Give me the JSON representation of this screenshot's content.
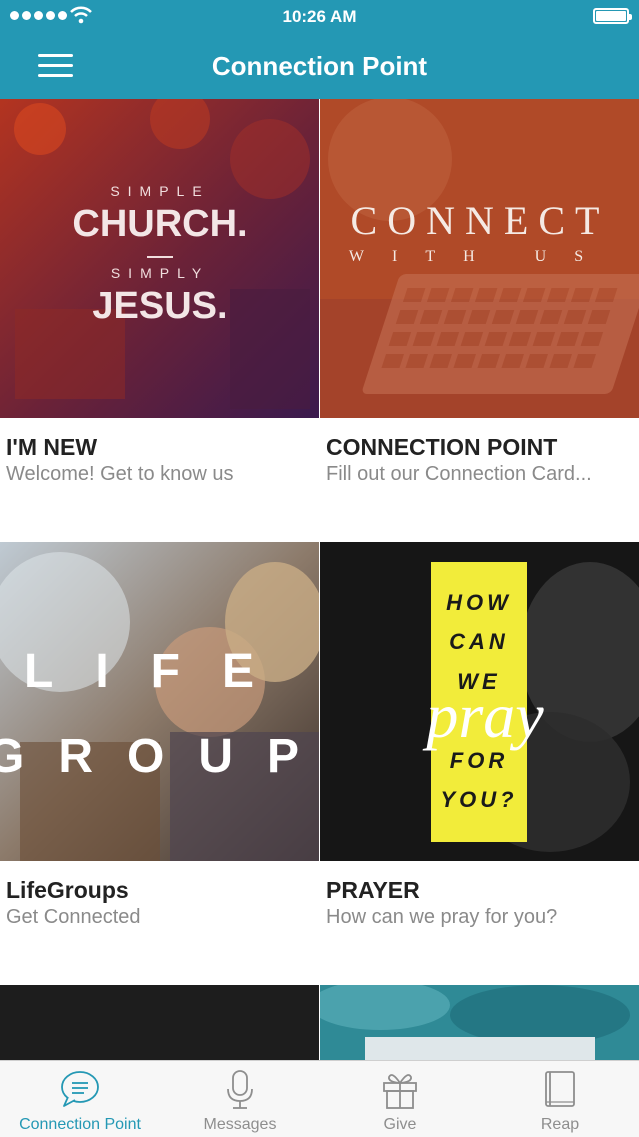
{
  "status_bar": {
    "time": "10:26 AM"
  },
  "header": {
    "title": "Connection Point"
  },
  "tiles": [
    {
      "title": "I'M NEW",
      "subtitle": "Welcome! Get to know us",
      "image_text": {
        "line1": "SIMPLE",
        "line2": "CHURCH.",
        "line3": "SIMPLY",
        "line4": "JESUS."
      }
    },
    {
      "title": "CONNECTION POINT",
      "subtitle": "Fill out our Connection Card...",
      "image_text": {
        "line1": "CONNECT",
        "line2": "WITH US"
      }
    },
    {
      "title": "LifeGroups",
      "subtitle": "Get Connected",
      "image_text": {
        "line1": "LIFE",
        "line2": "GROUP"
      }
    },
    {
      "title": "PRAYER",
      "subtitle": "How can we pray for you?",
      "image_text": {
        "line1": "HOW",
        "line2": "CAN",
        "line3": "WE",
        "line4": "pray",
        "line5": "FOR",
        "line6": "YOU?"
      }
    }
  ],
  "tab_bar": {
    "items": [
      {
        "label": "Connection Point",
        "icon": "chat-bubble-icon",
        "active": true
      },
      {
        "label": "Messages",
        "icon": "microphone-icon",
        "active": false
      },
      {
        "label": "Give",
        "icon": "gift-icon",
        "active": false
      },
      {
        "label": "Reap",
        "icon": "book-icon",
        "active": false
      }
    ]
  },
  "colors": {
    "accent": "#2498b4",
    "prayer_yellow": "#f2ec3a",
    "connect_orange": "#b4502a"
  }
}
